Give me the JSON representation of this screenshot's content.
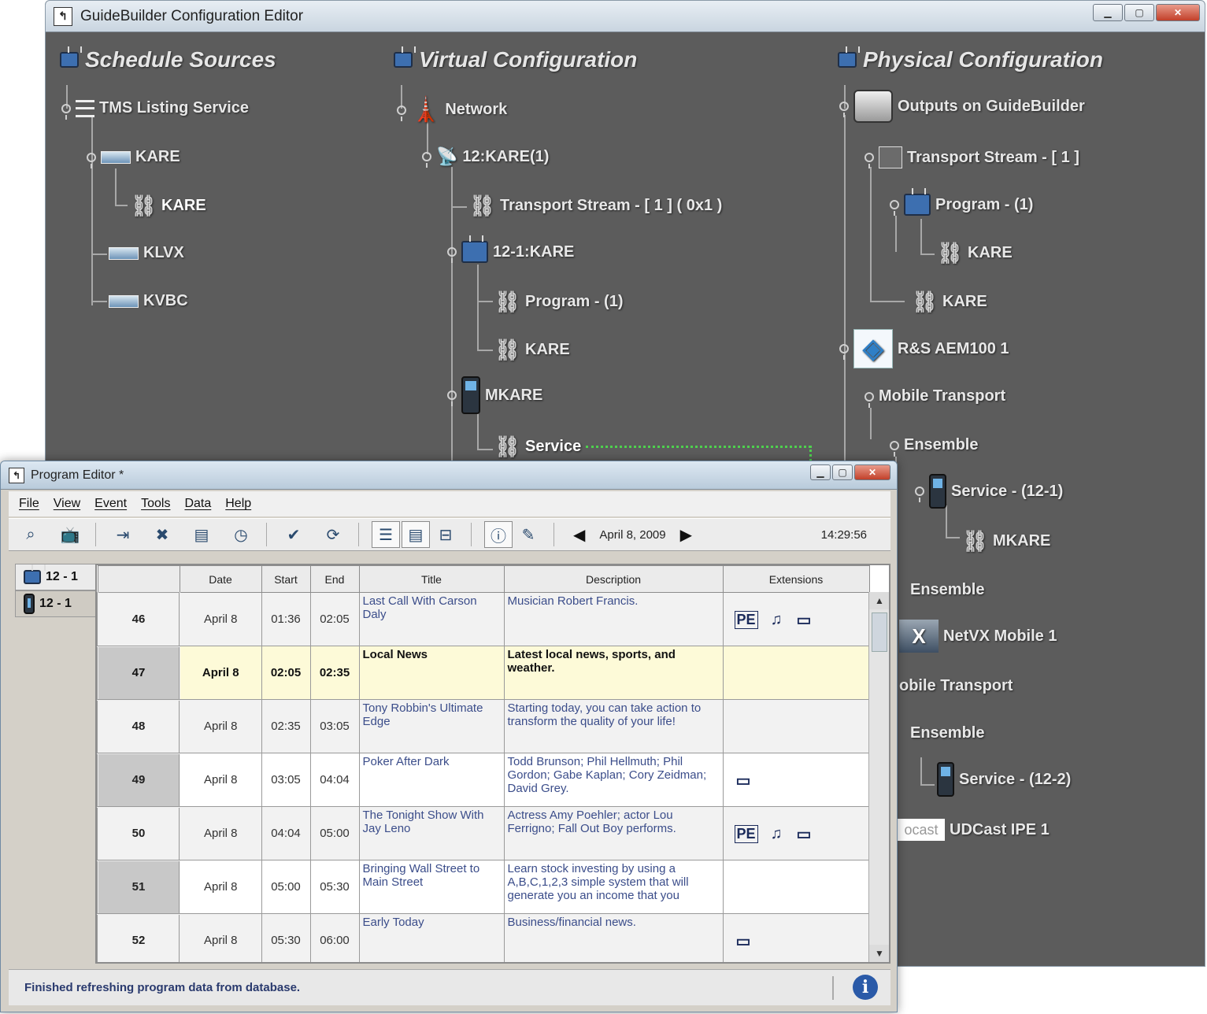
{
  "main_window": {
    "title": "GuideBuilder Configuration Editor"
  },
  "sections": {
    "schedule_sources": "Schedule Sources",
    "virtual_configuration": "Virtual Configuration",
    "physical_configuration": "Physical Configuration"
  },
  "schedule_tree": {
    "root": "TMS Listing Service",
    "kare": "KARE",
    "kare_child": "KARE",
    "klvx": "KLVX",
    "kvbc": "KVBC"
  },
  "virtual_tree": {
    "network": "Network",
    "kare12": "12:KARE(1)",
    "transport_stream": "Transport Stream - [ 1 ]  ( 0x1 )",
    "kare121": "12-1:KARE",
    "program": "Program - (1)",
    "kare": "KARE",
    "mkare": "MKARE",
    "service": "Service"
  },
  "physical_tree": {
    "outputs": "Outputs on GuideBuilder",
    "transport_stream": "Transport Stream - [ 1 ]",
    "program": "Program - (1)",
    "kare_a": "KARE",
    "kare_b": "KARE",
    "rs_aem": "R&S AEM100 1",
    "mobile_transport": "Mobile Transport",
    "ensemble_1": "Ensemble",
    "service_121": "Service - (12-1)",
    "mkare": "MKARE",
    "ensemble_2": "Ensemble",
    "netvx": "NetVX Mobile 1",
    "mobile_transport_2": "obile Transport",
    "ensemble_3": "Ensemble",
    "service_122": "Service - (12-2)",
    "udcast_logo": "ocast",
    "udcast": "UDCast IPE 1"
  },
  "program_editor": {
    "title": "Program Editor *",
    "menu": [
      "File",
      "View",
      "Event",
      "Tools",
      "Data",
      "Help"
    ],
    "date_label": "April 8, 2009",
    "time": "14:29:56",
    "tabs": [
      "12 - 1",
      "12 - 1"
    ],
    "columns": [
      "",
      "Date",
      "Start",
      "End",
      "Title",
      "Description",
      "Extensions"
    ],
    "rows": [
      {
        "num": "46",
        "date": "April  8",
        "start": "01:36",
        "end": "02:05",
        "title": "Last Call With Carson Daly",
        "desc": "Musician Robert Francis.",
        "ext": [
          "PE",
          "♫",
          "▭"
        ]
      },
      {
        "num": "47",
        "date": "April  8",
        "start": "02:05",
        "end": "02:35",
        "title": "Local  News",
        "desc": "Latest local news, sports, and weather.",
        "ext": []
      },
      {
        "num": "48",
        "date": "April  8",
        "start": "02:35",
        "end": "03:05",
        "title": "Tony Robbin's Ultimate Edge",
        "desc": "Starting today, you can take action to transform the quality of your life!",
        "ext": []
      },
      {
        "num": "49",
        "date": "April  8",
        "start": "03:05",
        "end": "04:04",
        "title": "Poker After Dark",
        "desc": "Todd Brunson; Phil Hellmuth; Phil Gordon; Gabe Kaplan; Cory Zeidman; David Grey.",
        "ext": [
          "▭"
        ]
      },
      {
        "num": "50",
        "date": "April  8",
        "start": "04:04",
        "end": "05:00",
        "title": "The Tonight Show With Jay Leno",
        "desc": "Actress Amy Poehler; actor Lou Ferrigno; Fall Out Boy performs.",
        "ext": [
          "PE",
          "♫",
          "▭"
        ]
      },
      {
        "num": "51",
        "date": "April  8",
        "start": "05:00",
        "end": "05:30",
        "title": "Bringing Wall Street to Main Street",
        "desc": "Learn stock investing by using a A,B,C,1,2,3 simple system that will generate you an income that you",
        "ext": []
      },
      {
        "num": "52",
        "date": "April  8",
        "start": "05:30",
        "end": "06:00",
        "title": "Early Today",
        "desc": "Business/financial news.",
        "ext": [
          "▭"
        ]
      }
    ],
    "status": "Finished refreshing program data from database."
  },
  "colors": {
    "canvas_bg": "#5c5c5c",
    "highlight_row": "#fdfad8",
    "link_green": "#4ed04e"
  }
}
